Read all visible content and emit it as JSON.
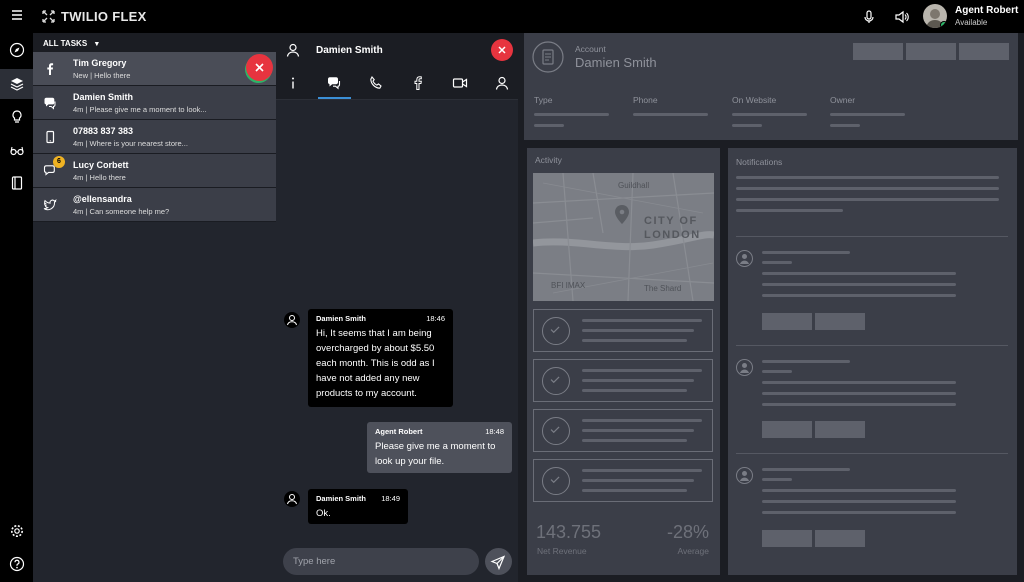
{
  "app": {
    "title": "TWILIO FLEX",
    "agent_name": "Agent Robert",
    "agent_status": "Available"
  },
  "tasks": {
    "filter_label": "ALL TASKS",
    "items": [
      {
        "name": "Tim Gregory",
        "subtitle": "New | Hello there",
        "channel": "facebook-icon",
        "active": true
      },
      {
        "name": "Damien Smith",
        "subtitle": "4m | Please give me a moment to look...",
        "channel": "chat-icon"
      },
      {
        "name": "07883 837 383",
        "subtitle": "4m | Where is your nearest store...",
        "channel": "mobile-icon"
      },
      {
        "name": "Lucy Corbett",
        "subtitle": "4m | Hello there",
        "channel": "chat-icon",
        "badge": "6"
      },
      {
        "name": "@ellensandra",
        "subtitle": "4m | Can someone help me?",
        "channel": "twitter-icon"
      }
    ]
  },
  "conversation": {
    "title": "Damien Smith",
    "messages": [
      {
        "from": "Damien Smith",
        "time": "18:46",
        "text": "Hi, It seems that I am being overcharged by about $5.50 each month. This is odd as I have not added any new products to my account."
      },
      {
        "from": "Agent Robert",
        "time": "18:48",
        "text": "Please give me a moment to look up your file."
      },
      {
        "from": "Damien Smith",
        "time": "18:49",
        "text": "Ok."
      }
    ],
    "input_placeholder": "Type here"
  },
  "crm": {
    "account_label": "Account",
    "account_name": "Damien Smith",
    "fields": [
      "Type",
      "Phone",
      "On Website",
      "Owner"
    ],
    "activity_label": "Activity",
    "map_labels": {
      "guildhall": "Guildhall",
      "city": "CITY OF",
      "london": "LONDON",
      "bfi": "BFI IMAX",
      "shard": "The Shard"
    },
    "revenue_value": "143.755",
    "revenue_label": "Net Revenue",
    "average_value": "-28%",
    "average_label": "Average",
    "notifications_label": "Notifications"
  }
}
